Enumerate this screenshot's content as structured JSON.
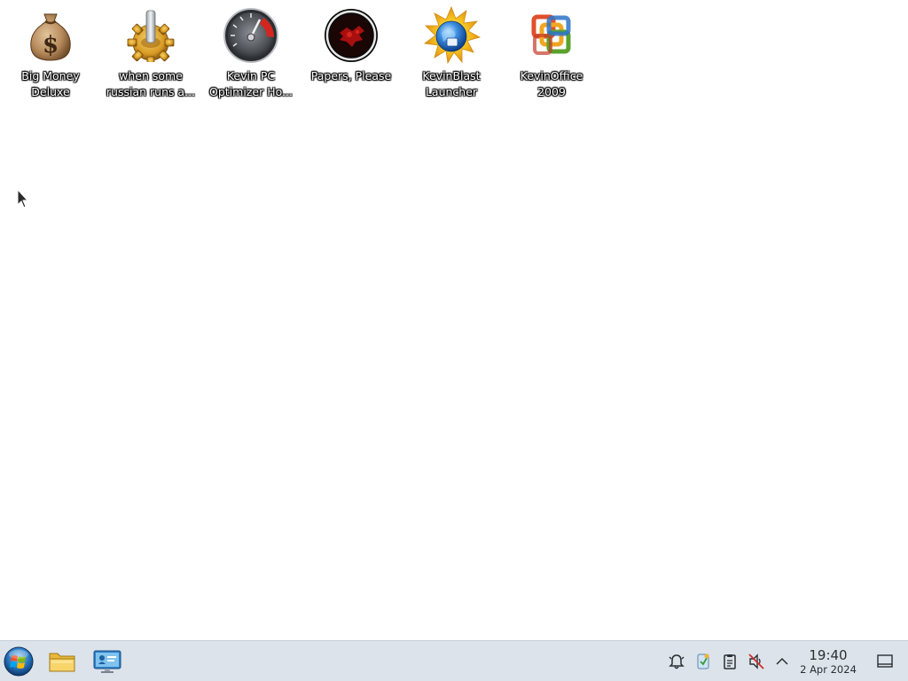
{
  "desktop": {
    "icons": [
      {
        "label": "Big Money\nDeluxe",
        "icon": "money-bag-icon"
      },
      {
        "label": "when some\nrussian runs a...",
        "icon": "gear-icon"
      },
      {
        "label": "Kevin PC\nOptimizer Ho...",
        "icon": "speedometer-icon"
      },
      {
        "label": "Papers, Please",
        "icon": "red-emblem-icon"
      },
      {
        "label": "KevinBlast\nLauncher",
        "icon": "globe-burst-icon"
      },
      {
        "label": "KevinOffice\n2009",
        "icon": "office-logo-icon"
      }
    ]
  },
  "taskbar": {
    "start": {
      "icon": "start-orb-icon"
    },
    "pinned": [
      {
        "icon": "folder-icon"
      },
      {
        "icon": "monitor-icon"
      }
    ],
    "tray": [
      {
        "icon": "notification-bell-icon"
      },
      {
        "icon": "updates-icon"
      },
      {
        "icon": "clipboard-icon"
      },
      {
        "icon": "muted-volume-icon"
      },
      {
        "icon": "chevron-up-icon"
      }
    ],
    "clock": {
      "time": "19:40",
      "date": "2 Apr 2024"
    },
    "show_desktop": {
      "icon": "show-desktop-icon"
    }
  },
  "colors": {
    "taskbar_bg": "#dce3ea",
    "desktop_bg": "#ffffff"
  }
}
